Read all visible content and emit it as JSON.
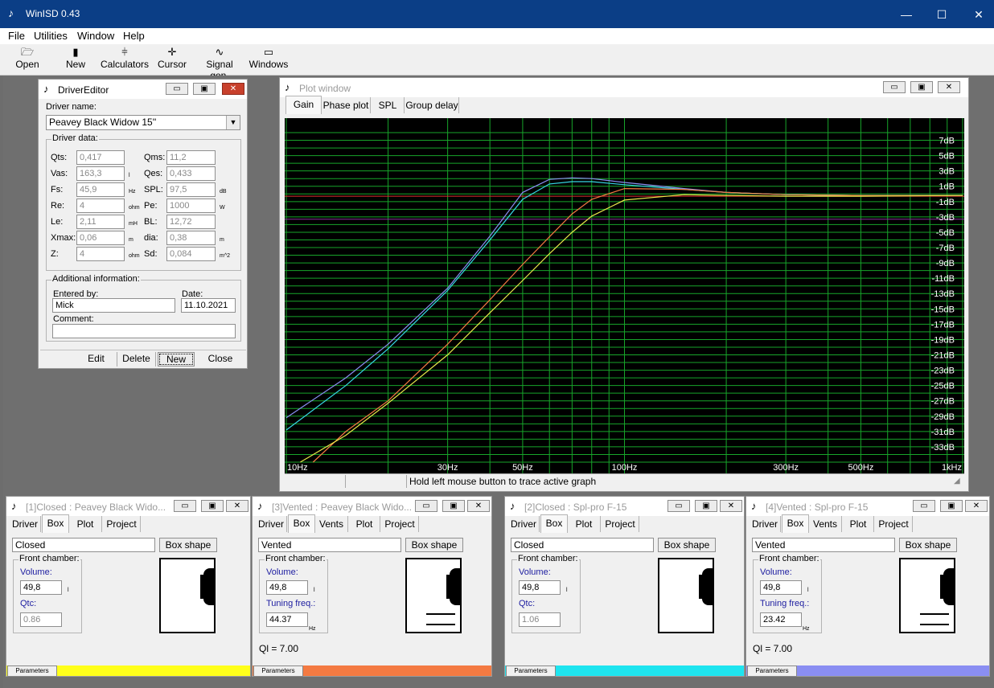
{
  "app": {
    "title": "WinISD 0.43",
    "minimize": "—",
    "maximize": "☐",
    "close": "✕"
  },
  "menu": [
    "File",
    "Utilities",
    "Window",
    "Help"
  ],
  "toolbar": [
    {
      "label": "Open",
      "icon": "folder-open-icon",
      "glyph": "🗁"
    },
    {
      "label": "New",
      "icon": "new-driver-icon",
      "glyph": "▮"
    },
    {
      "label": "Calculators",
      "icon": "calculators-icon",
      "glyph": "⫩"
    },
    {
      "label": "Cursor",
      "icon": "cursor-icon",
      "glyph": "✛"
    },
    {
      "label": "Signal gen.",
      "icon": "signal-generator-icon",
      "glyph": "∿"
    },
    {
      "label": "Windows",
      "icon": "windows-icon",
      "glyph": "▭"
    }
  ],
  "driver_editor": {
    "title": "DriverEditor",
    "driver_name_label": "Driver name:",
    "driver_name_value": "Peavey Black Widow 15''",
    "driver_data_label": "Driver data:",
    "params": [
      {
        "label": "Qts:",
        "value": "0,417",
        "unit": ""
      },
      {
        "label": "Vas:",
        "value": "163,3",
        "unit": "l"
      },
      {
        "label": "Fs:",
        "value": "45,9",
        "unit": "Hz"
      },
      {
        "label": "Re:",
        "value": "4",
        "unit": "ohm"
      },
      {
        "label": "Le:",
        "value": "2,11",
        "unit": "mH"
      },
      {
        "label": "Xmax:",
        "value": "0,06",
        "unit": "m"
      },
      {
        "label": "Z:",
        "value": "4",
        "unit": "ohm"
      }
    ],
    "params_right": [
      {
        "label": "Qms:",
        "value": "11,2",
        "unit": ""
      },
      {
        "label": "Qes:",
        "value": "0,433",
        "unit": ""
      },
      {
        "label": "SPL:",
        "value": "97,5",
        "unit": "dB"
      },
      {
        "label": "Pe:",
        "value": "1000",
        "unit": "W"
      },
      {
        "label": "BL:",
        "value": "12,72",
        "unit": ""
      },
      {
        "label": "dia:",
        "value": "0,38",
        "unit": "m"
      },
      {
        "label": "Sd:",
        "value": "0,084",
        "unit": "m^2"
      }
    ],
    "additional_label": "Additional information:",
    "entered_by_label": "Entered by:",
    "entered_by_value": "Mick",
    "date_label": "Date:",
    "date_value": "11.10.2021",
    "comment_label": "Comment:",
    "comment_value": "",
    "buttons": [
      "Edit",
      "Delete",
      "New",
      "Close"
    ]
  },
  "plot_window": {
    "title": "Plot window",
    "tabs": [
      "Gain",
      "Phase plot",
      "SPL",
      "Group delay"
    ],
    "status": "Hold left mouse button to trace active graph",
    "background": "#000000",
    "grid_color": "#17a52a",
    "ref_line_color": "#e03030"
  },
  "chart_data": {
    "type": "line",
    "x_scale": "log",
    "xlim": [
      10,
      1000
    ],
    "ylim": [
      -35,
      8
    ],
    "x_tick_labels": [
      {
        "x": 10,
        "label": "10Hz"
      },
      {
        "x": 30,
        "label": "30Hz"
      },
      {
        "x": 50,
        "label": "50Hz"
      },
      {
        "x": 100,
        "label": "100Hz"
      },
      {
        "x": 300,
        "label": "300Hz"
      },
      {
        "x": 500,
        "label": "500Hz"
      },
      {
        "x": 1000,
        "label": "1kHz"
      }
    ],
    "y_ticks": [
      7,
      5,
      3,
      1,
      -1,
      -3,
      -5,
      -7,
      -9,
      -11,
      -13,
      -15,
      -17,
      -19,
      -21,
      -23,
      -25,
      -27,
      -29,
      -31,
      -33
    ],
    "y_tick_suffix": "dB",
    "ref_lines": [
      -0.3,
      -3.3
    ],
    "series": [
      {
        "color": "#8a8ef2",
        "points": [
          [
            10,
            -29.2
          ],
          [
            15,
            -24
          ],
          [
            20,
            -19.6
          ],
          [
            30,
            -12.3
          ],
          [
            40,
            -5.5
          ],
          [
            50,
            0.2
          ],
          [
            60,
            1.9
          ],
          [
            70,
            2.1
          ],
          [
            80,
            2.0
          ],
          [
            100,
            1.5
          ],
          [
            150,
            0.7
          ],
          [
            200,
            0.2
          ],
          [
            300,
            -0.1
          ],
          [
            500,
            -0.2
          ],
          [
            1000,
            -0.2
          ]
        ]
      },
      {
        "color": "#37d7e4",
        "points": [
          [
            10,
            -30.8
          ],
          [
            15,
            -25
          ],
          [
            20,
            -20.2
          ],
          [
            30,
            -12.6
          ],
          [
            40,
            -6
          ],
          [
            50,
            -0.7
          ],
          [
            60,
            1.3
          ],
          [
            70,
            1.6
          ],
          [
            80,
            1.6
          ],
          [
            100,
            1.2
          ],
          [
            150,
            0.6
          ],
          [
            200,
            0.2
          ],
          [
            300,
            -0.1
          ],
          [
            500,
            -0.2
          ],
          [
            1000,
            -0.2
          ]
        ]
      },
      {
        "color": "#f47a42",
        "points": [
          [
            12,
            -35
          ],
          [
            15,
            -31
          ],
          [
            20,
            -27
          ],
          [
            30,
            -19.6
          ],
          [
            40,
            -13.8
          ],
          [
            50,
            -9.2
          ],
          [
            60,
            -5.6
          ],
          [
            70,
            -2.6
          ],
          [
            80,
            -0.7
          ],
          [
            100,
            0.7
          ],
          [
            150,
            0.6
          ],
          [
            200,
            0.2
          ],
          [
            300,
            -0.1
          ],
          [
            500,
            -0.2
          ],
          [
            1000,
            -0.2
          ]
        ]
      },
      {
        "color": "#e8e84a",
        "points": [
          [
            11,
            -35
          ],
          [
            15,
            -31.5
          ],
          [
            20,
            -27.3
          ],
          [
            30,
            -21
          ],
          [
            40,
            -15.5
          ],
          [
            50,
            -11.3
          ],
          [
            60,
            -7.8
          ],
          [
            70,
            -5
          ],
          [
            80,
            -2.9
          ],
          [
            100,
            -0.8
          ],
          [
            150,
            -0.1
          ],
          [
            200,
            -0.2
          ],
          [
            300,
            -0.3
          ],
          [
            500,
            -0.3
          ],
          [
            1000,
            -0.2
          ]
        ]
      }
    ]
  },
  "projects": [
    {
      "title": "[1]Closed : Peavey Black Wido...",
      "tabs": [
        "Driver",
        "Box",
        "Plot",
        "Project"
      ],
      "box_type": "Closed",
      "box_shape_label": "Box shape",
      "front_chamber_label": "Front chamber:",
      "volume_label": "Volume:",
      "volume": "49,8",
      "volume_unit": "l",
      "second_label": "Qtc:",
      "second_value": "0.86",
      "second_unit": "",
      "ql": "",
      "params_label": "Parameters",
      "color": "#ffff1a",
      "vented": false
    },
    {
      "title": "[3]Vented : Peavey Black Wido...",
      "tabs": [
        "Driver",
        "Box",
        "Vents",
        "Plot",
        "Project"
      ],
      "box_type": "Vented",
      "box_shape_label": "Box shape",
      "front_chamber_label": "Front chamber:",
      "volume_label": "Volume:",
      "volume": "49,8",
      "volume_unit": "l",
      "second_label": "Tuning freq.:",
      "second_value": "44.37",
      "second_unit": "Hz",
      "ql": "Ql = 7.00",
      "params_label": "Parameters",
      "color": "#f47a42",
      "vented": true
    },
    {
      "title": "[2]Closed : Spl-pro F-15",
      "tabs": [
        "Driver",
        "Box",
        "Plot",
        "Project"
      ],
      "box_type": "Closed",
      "box_shape_label": "Box shape",
      "front_chamber_label": "Front chamber:",
      "volume_label": "Volume:",
      "volume": "49,8",
      "volume_unit": "l",
      "second_label": "Qtc:",
      "second_value": "1.06",
      "second_unit": "",
      "ql": "",
      "params_label": "Parameters",
      "color": "#1ee4ef",
      "vented": false
    },
    {
      "title": "[4]Vented : Spl-pro F-15",
      "tabs": [
        "Driver",
        "Box",
        "Vents",
        "Plot",
        "Project"
      ],
      "box_type": "Vented",
      "box_shape_label": "Box shape",
      "front_chamber_label": "Front chamber:",
      "volume_label": "Volume:",
      "volume": "49,8",
      "volume_unit": "l",
      "second_label": "Tuning freq.:",
      "second_value": "23.42",
      "second_unit": "Hz",
      "ql": "Ql = 7.00",
      "params_label": "Parameters",
      "color": "#8a8ef2",
      "vented": true
    }
  ]
}
